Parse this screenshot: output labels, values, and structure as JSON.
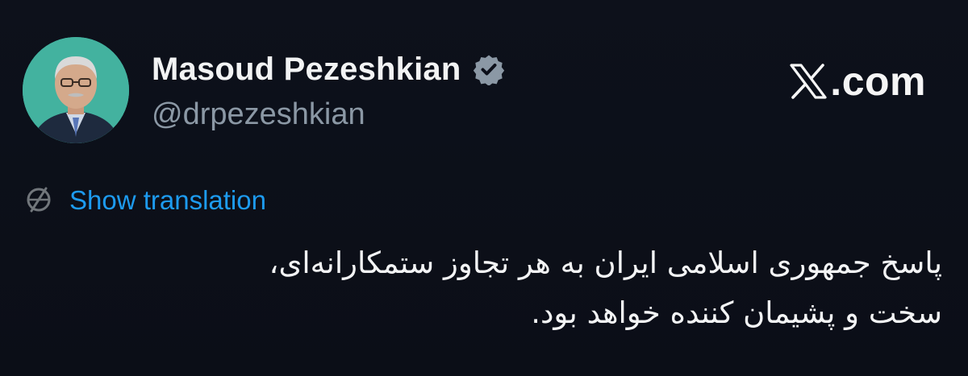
{
  "author": {
    "display_name": "Masoud Pezeshkian",
    "handle": "@drpezeshkian",
    "verified": true
  },
  "brand": {
    "logo_icon": "x-logo-icon",
    "domain_suffix": ".com"
  },
  "translation": {
    "icon": "globe-icon",
    "label": "Show translation"
  },
  "tweet": {
    "lines": [
      "پاسخ جمهوری اسلامی ایران به هر تجاوز ستمکارانه‌ای،",
      "سخت و پشیمان کننده خواهد بود."
    ]
  },
  "colors": {
    "background": "#0c0f19",
    "link": "#1d9bf0",
    "secondary_text": "#8b98a5",
    "verified_badge": "#8b98a5"
  }
}
